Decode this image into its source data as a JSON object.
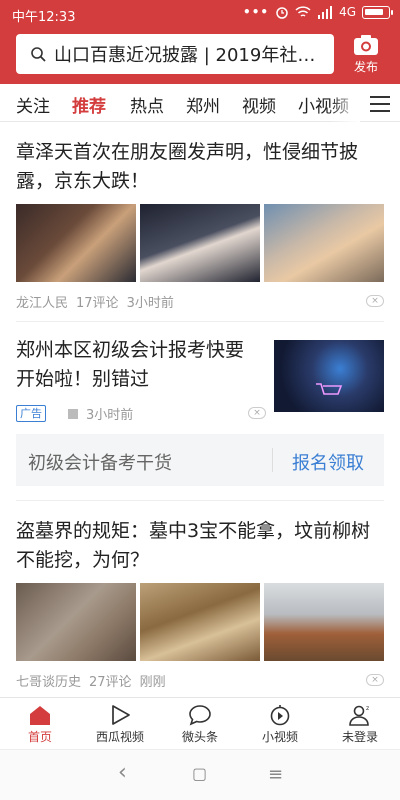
{
  "status_bar": {
    "time": "中午12:33",
    "dots": "•••",
    "network": "4G"
  },
  "search": {
    "query": "山口百惠近况披露 | 2019年社…"
  },
  "publish": {
    "label": "发布"
  },
  "tabs": [
    {
      "label": "关注",
      "active": false
    },
    {
      "label": "推荐",
      "active": true
    },
    {
      "label": "热点",
      "active": false
    },
    {
      "label": "郑州",
      "active": false
    },
    {
      "label": "视频",
      "active": false
    },
    {
      "label": "小视频",
      "active": false
    }
  ],
  "articles": [
    {
      "title": "章泽天首次在朋友圈发声明，性侵细节披露，京东大跌！",
      "source": "龙江人民",
      "comments": "17评论",
      "time": "3小时前"
    },
    {
      "title": "郑州本区初级会计报考快要开始啦！别错过",
      "ad_tag": "广告",
      "time": "3小时前",
      "ad_left": "初级会计备考干货",
      "ad_right": "报名领取"
    },
    {
      "title": "盗墓界的规矩：墓中3宝不能拿，坟前柳树不能挖，为何？",
      "source": "七哥谈历史",
      "comments": "27评论",
      "time": "刚刚"
    }
  ],
  "dismiss_glyph": "×",
  "bottom_nav": [
    {
      "label": "首页",
      "icon": "home-icon",
      "active": true
    },
    {
      "label": "西瓜视频",
      "icon": "play-icon",
      "active": false
    },
    {
      "label": "微头条",
      "icon": "chat-bubble-icon",
      "active": false
    },
    {
      "label": "小视频",
      "icon": "short-video-icon",
      "active": false
    },
    {
      "label": "未登录",
      "icon": "user-icon",
      "active": false
    }
  ],
  "system_nav": {
    "back": "‹",
    "home": "▢",
    "menu": "≡"
  },
  "colors": {
    "brand": "#d43d3d",
    "ad_blue": "#3b7fd4"
  }
}
